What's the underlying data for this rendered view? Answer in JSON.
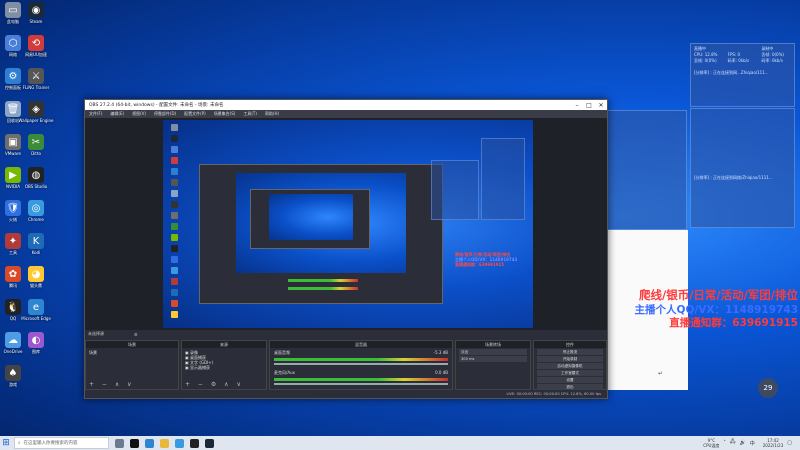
{
  "desktop_icons": [
    {
      "label": "此电脑",
      "color": "#7f8ea3",
      "glyph": "▭"
    },
    {
      "label": "Steam",
      "color": "#1b2838",
      "glyph": "◉"
    },
    {
      "label": "网络",
      "color": "#4a7ed8",
      "glyph": "⬡"
    },
    {
      "label": "网易UU加速",
      "color": "#d13b3b",
      "glyph": "⟲"
    },
    {
      "label": "控制面板",
      "color": "#2e7fd1",
      "glyph": "⚙"
    },
    {
      "label": "FLiNG Trainer",
      "color": "#555",
      "glyph": "⚔"
    },
    {
      "label": "回收站",
      "color": "#8aa4c8",
      "glyph": "🗑"
    },
    {
      "label": "Wallpaper Engine",
      "color": "#333",
      "glyph": "◈"
    },
    {
      "label": "VMware",
      "color": "#6e6e6e",
      "glyph": "▣"
    },
    {
      "label": "Ditto",
      "color": "#3a8b3a",
      "glyph": "✂"
    },
    {
      "label": "NVIDIA",
      "color": "#76b900",
      "glyph": "▶"
    },
    {
      "label": "OBS Studio",
      "color": "#222",
      "glyph": "◍"
    },
    {
      "label": "火绒",
      "color": "#2f6fe0",
      "glyph": "🛡"
    },
    {
      "label": "Chrome",
      "color": "#3a9ae0",
      "glyph": "◎"
    },
    {
      "label": "工具",
      "color": "#b23a3a",
      "glyph": "✦"
    },
    {
      "label": "Kodi",
      "color": "#1f6bb5",
      "glyph": "K"
    },
    {
      "label": "腾讯",
      "color": "#d84a2a",
      "glyph": "✿"
    },
    {
      "label": "猫头鹰",
      "color": "#ffc934",
      "glyph": "◕"
    },
    {
      "label": "QQ",
      "color": "#222",
      "glyph": "🐧"
    },
    {
      "label": "Microsoft Edge",
      "color": "#2f86d0",
      "glyph": "e"
    },
    {
      "label": "OneDrive",
      "color": "#4e9ce6",
      "glyph": "☁"
    },
    {
      "label": "图库",
      "color": "#9b59d0",
      "glyph": "◐"
    },
    {
      "label": "游戏",
      "color": "#444",
      "glyph": "♠"
    }
  ],
  "obs": {
    "title": "OBS 27.2.4 (64-bit, windows) - 配置文件: 未命名 - 场景: 未命名",
    "menu": [
      "文件(F)",
      "编辑(E)",
      "视图(V)",
      "停靠部件(D)",
      "配置文件(P)",
      "场景集合(S)",
      "工具(T)",
      "帮助(H)"
    ],
    "bottom_bar": "未选择源",
    "docks": {
      "scenes_title": "场景",
      "scenes": [
        "场景"
      ],
      "sources_title": "来源",
      "sources": [
        "录像",
        "桌面捕获",
        "文字 (GDI+)",
        "显示器捕获"
      ],
      "mixer_title": "混音器",
      "mixer": [
        {
          "name": "桌面音频",
          "db": "-5.3 dB"
        },
        {
          "name": "麦克风/Aux",
          "db": "0.0 dB"
        }
      ],
      "transitions_title": "场景转场",
      "transition_type": "淡出",
      "transition_duration": "300 ms",
      "controls_title": "控件",
      "controls": [
        "停止推流",
        "开始录制",
        "启动虚拟摄像机",
        "工作室模式",
        "设置",
        "退出"
      ]
    },
    "status": "LIVE: 00:00:00   REC: 00:00:00   CPU: 12.8%, 60.00 fps"
  },
  "stat_panel_top": {
    "rows": [
      [
        "直播中",
        "",
        "录制中"
      ],
      [
        "CPU: 12.8%",
        "FPS: 0",
        "丢帧: 0(0%)"
      ],
      [
        "丢帧: 0(0%)",
        "码率: 0kb/s",
        "码率: 0kb/s"
      ]
    ],
    "line": "[分辨率] : 正在连接到网...Zhiqiao/111..."
  },
  "stat_panel_mid": {
    "line1": "[分辨率] : 正在连接到网络/Zhiqiao/1111..."
  },
  "promo": {
    "line1": "爬线/银币/日常/活动/军团/排位",
    "line2": "主播个人QQ/VX：1148919743",
    "line3": "直播通知群：639691915"
  },
  "taskbar": {
    "search_placeholder": "在这里输入你要搜索的内容",
    "temp": "9°C",
    "weather": "CPU温度",
    "time": "17:42",
    "date": "2022/1/23"
  },
  "counter_badge": "29",
  "colors": {
    "accent": "#1267e0",
    "promo_red": "#ff3b3b",
    "promo_blue": "#3a6dff"
  }
}
